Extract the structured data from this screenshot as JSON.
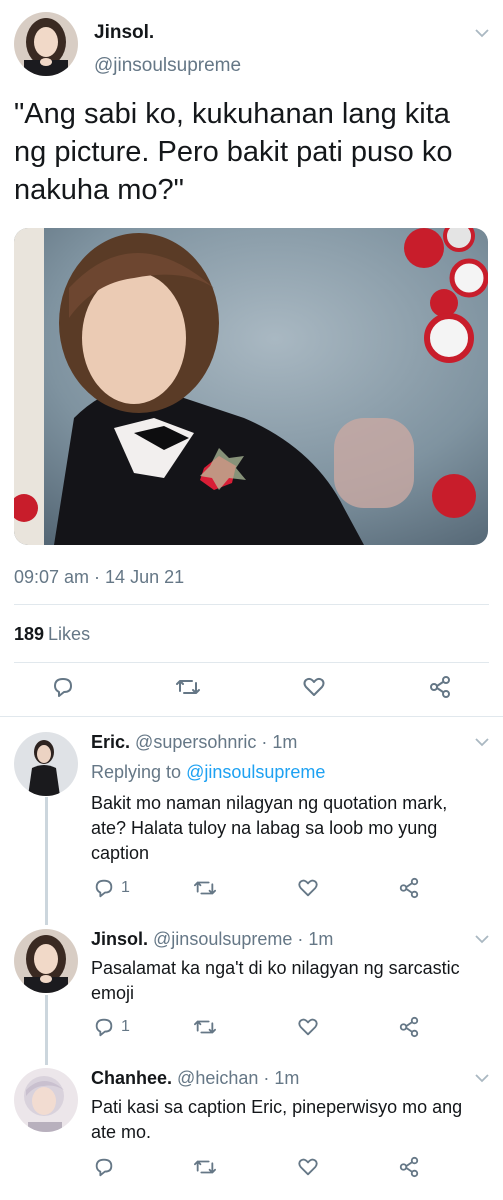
{
  "main_tweet": {
    "name": "Jinsol.",
    "handle": "@jinsoulsupreme",
    "text": "\"Ang sabi ko, kukuhanan lang kita ng picture. Pero bakit pati puso ko nakuha mo?\"",
    "timestamp": "09:07 am · 14 Jun 21",
    "likes_count": "189",
    "likes_label": "Likes"
  },
  "replies": [
    {
      "name": "Eric.",
      "handle": "@supersohnric",
      "time": "· 1m",
      "replying_label": "Replying to",
      "replying_to": "@jinsoulsupreme",
      "text": "Bakit mo naman nilagyan ng quotation mark, ate? Halata tuloy na labag sa loob mo yung caption",
      "reply_count": "1"
    },
    {
      "name": "Jinsol.",
      "handle": "@jinsoulsupreme",
      "time": "· 1m",
      "text": "Pasalamat ka nga't di ko nilagyan ng sarcastic emoji",
      "reply_count": "1"
    },
    {
      "name": "Chanhee.",
      "handle": "@heichan",
      "time": "· 1m",
      "text": "Pati kasi sa caption Eric, pineperwisyo mo ang ate mo.",
      "reply_count": ""
    }
  ],
  "icons": [
    "reply-icon",
    "retweet-icon",
    "like-icon",
    "share-icon",
    "chevron-down-icon"
  ],
  "colors": {
    "text": "#14171a",
    "secondary": "#657786",
    "accent": "#1da1f2",
    "divider": "#e1e8ed"
  }
}
